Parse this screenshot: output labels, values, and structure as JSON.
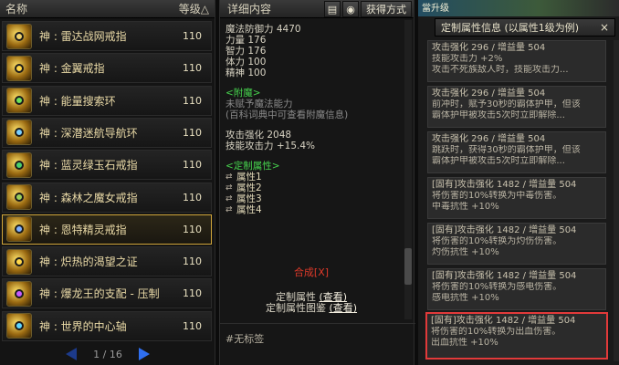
{
  "left": {
    "col_name": "名称",
    "col_level": "等级",
    "sort_icon": "△",
    "items": [
      {
        "name": "神 : 雷达战网戒指",
        "level": "110",
        "gem": "#f0d36a"
      },
      {
        "name": "神 : 金翼戒指",
        "level": "110",
        "gem": "#ffd84a"
      },
      {
        "name": "神 : 能量搜索环",
        "level": "110",
        "gem": "#6de35a"
      },
      {
        "name": "神 : 深潜迷航导航环",
        "level": "110",
        "gem": "#7ad0ff"
      },
      {
        "name": "神 : 蓝灵绿玉石戒指",
        "level": "110",
        "gem": "#4bd16c"
      },
      {
        "name": "神 : 森林之魔女戒指",
        "level": "110",
        "gem": "#9bd05a"
      },
      {
        "name": "神 : 恩特精灵戒指",
        "level": "110",
        "gem": "#7fb0ff"
      },
      {
        "name": "神 : 炽热的渴望之证",
        "level": "110",
        "gem": "#ffd84a"
      },
      {
        "name": "神 : 爆龙王的支配 - 压制",
        "level": "110",
        "gem": "#c55cff"
      },
      {
        "name": "神 : 世界的中心轴",
        "level": "110",
        "gem": "#5fd6ff"
      }
    ],
    "selected_index": 6,
    "page": "1 / 16"
  },
  "mid": {
    "title": "详细内容",
    "btn_settings": "▤",
    "btn_eye": "◉",
    "btn_source": "获得方式",
    "stats": [
      {
        "label": "魔法防御力",
        "value": "4470"
      },
      {
        "label": "力量",
        "value": "176"
      },
      {
        "label": "智力",
        "value": "176"
      },
      {
        "label": "体力",
        "value": "100"
      },
      {
        "label": "精神",
        "value": "100"
      }
    ],
    "enchant_title": "<附魔>",
    "enchant_line1": "未赋予魔法能力",
    "enchant_line2": "(百科词典中可查看附魔信息)",
    "attack_line1": "攻击强化 2048",
    "attack_line2": "技能攻击力 +15.4%",
    "custom_title": "<定制属性>",
    "custom_attrs": [
      "属性1",
      "属性2",
      "属性3",
      "属性4"
    ],
    "synth": "合成[X]",
    "custom_link1_text": "定制属性 ",
    "custom_link1_view": "(查看)",
    "custom_link2_text": "定制属性图鉴 ",
    "custom_link2_view": "(查看)",
    "tag": "#无标签"
  },
  "right": {
    "banner": "當升级",
    "title": "定制属性信息 (以属性1级为例)",
    "close": "×",
    "cards": [
      {
        "l1": "攻击强化 296 / 增益量 504",
        "l2": "技能攻击力 +2%",
        "l3": "攻击不死族敌人时，技能攻击力..."
      },
      {
        "l1": "攻击强化 296 / 增益量 504",
        "l2": "前冲时，赋予30秒的霸体护甲，但该",
        "l3": "霸体护甲被攻击5次时立即解除..."
      },
      {
        "l1": "攻击强化 296 / 增益量 504",
        "l2": "跳跃时，获得30秒的霸体护甲，但该",
        "l3": "霸体护甲被攻击5次时立即解除..."
      },
      {
        "l1": "[固有]攻击强化 1482 / 增益量 504",
        "l2": "将伤害的10%转换为中毒伤害。",
        "l3": "中毒抗性 +10%"
      },
      {
        "l1": "[固有]攻击强化 1482 / 增益量 504",
        "l2": "将伤害的10%转换为灼伤伤害。",
        "l3": "灼伤抗性 +10%"
      },
      {
        "l1": "[固有]攻击强化 1482 / 增益量 504",
        "l2": "将伤害的10%转换为感电伤害。",
        "l3": "感电抗性 +10%"
      },
      {
        "l1": "[固有]攻击强化 1482 / 增益量 504",
        "l2": "将伤害的10%转换为出血伤害。",
        "l3": "出血抗性 +10%"
      }
    ],
    "highlight_index": 6,
    "highlight_color": "#e23a3a"
  }
}
